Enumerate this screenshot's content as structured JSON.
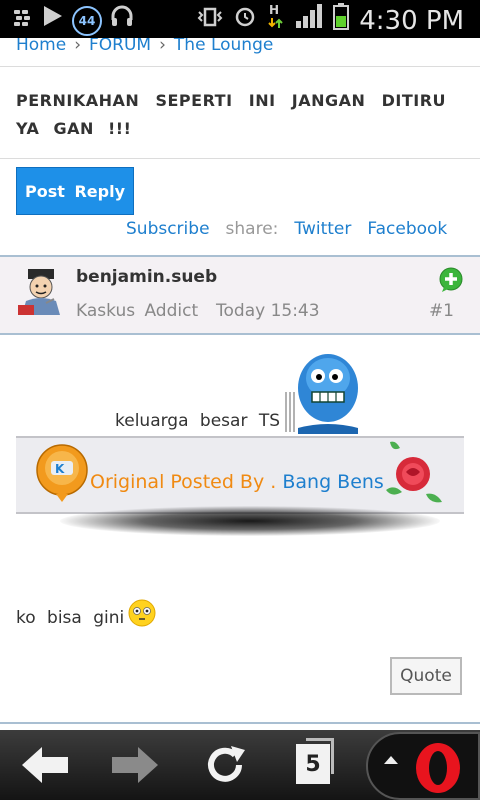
{
  "status_bar": {
    "time": "4:30 PM",
    "notification_count": "44"
  },
  "breadcrumb": {
    "items": [
      "Home",
      "FORUM",
      "The Lounge"
    ],
    "separator": "›"
  },
  "thread": {
    "title": "PERNIKAHAN SEPERTI INI JANGAN DITIRU YA GAN !!!"
  },
  "actions": {
    "post_reply": "Post Reply",
    "subscribe": "Subscribe",
    "share_label": "share:",
    "twitter": "Twitter",
    "facebook": "Facebook"
  },
  "post": {
    "username": "benjamin.sueb",
    "rank": "Kaskus Addict",
    "time": "Today 15:43",
    "number": "#1",
    "line1": "keluarga besar TS",
    "quote_prefix": "Original Posted By .",
    "quote_name": "Bang Bens",
    "line2": "ko bisa gini",
    "quote_button": "Quote"
  },
  "browser": {
    "tab_count": "5"
  },
  "colors": {
    "link": "#1e7fce",
    "accent_button": "#1e90e8",
    "opera_red": "#e8141e",
    "plus_green": "#3bb53b"
  }
}
